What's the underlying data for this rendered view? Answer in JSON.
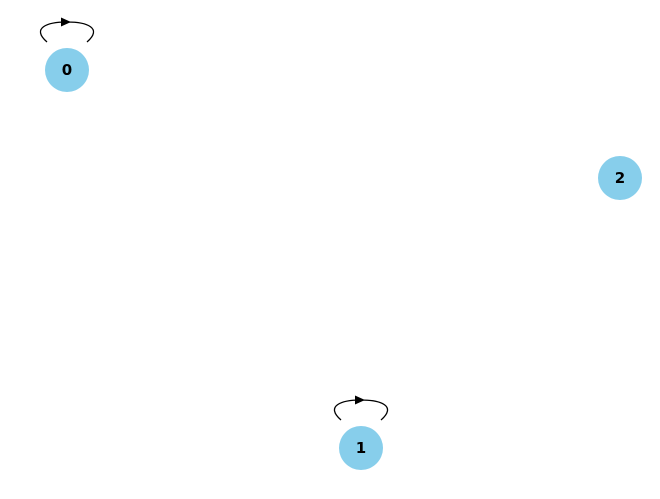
{
  "graph": {
    "node_color": "#87CEEB",
    "edge_color": "#000000",
    "label_color": "#000000",
    "directed": true,
    "nodes": [
      {
        "id": "0",
        "label": "0"
      },
      {
        "id": "1",
        "label": "1"
      },
      {
        "id": "2",
        "label": "2"
      }
    ],
    "edges": [
      {
        "source": "0",
        "target": "0"
      },
      {
        "source": "1",
        "target": "1"
      }
    ]
  }
}
